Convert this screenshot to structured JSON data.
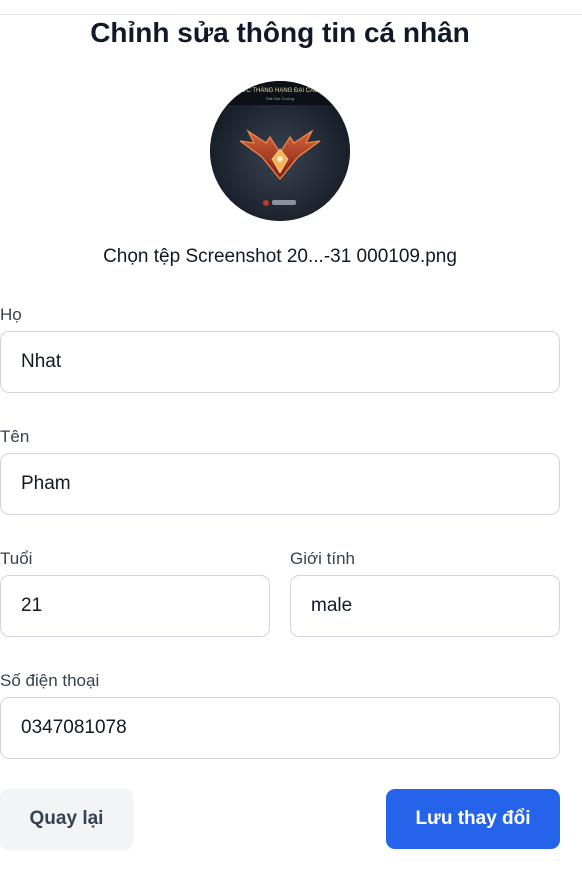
{
  "header": {
    "title": "Chỉnh sửa thông tin cá nhân"
  },
  "avatar": {
    "icon": "rank-emblem-image",
    "caption_top": "ỨC THÀNG HẠNG ĐẠI CAO",
    "caption_bottom": "Rất Kim Cương"
  },
  "file_picker": {
    "label": "Chọn tệp Screenshot 20...-31 000109.png"
  },
  "form": {
    "last_name": {
      "label": "Họ",
      "value": "Nhat"
    },
    "first_name": {
      "label": "Tên",
      "value": "Pham"
    },
    "age": {
      "label": "Tuổi",
      "value": "21"
    },
    "gender": {
      "label": "Giới tính",
      "value": "male"
    },
    "phone": {
      "label": "Số điện thoại",
      "value": "0347081078"
    }
  },
  "actions": {
    "back_label": "Quay lại",
    "save_label": "Lưu thay đổi"
  },
  "colors": {
    "primary": "#2563eb",
    "secondary_bg": "#f3f4f6",
    "border": "#d1d5db"
  }
}
